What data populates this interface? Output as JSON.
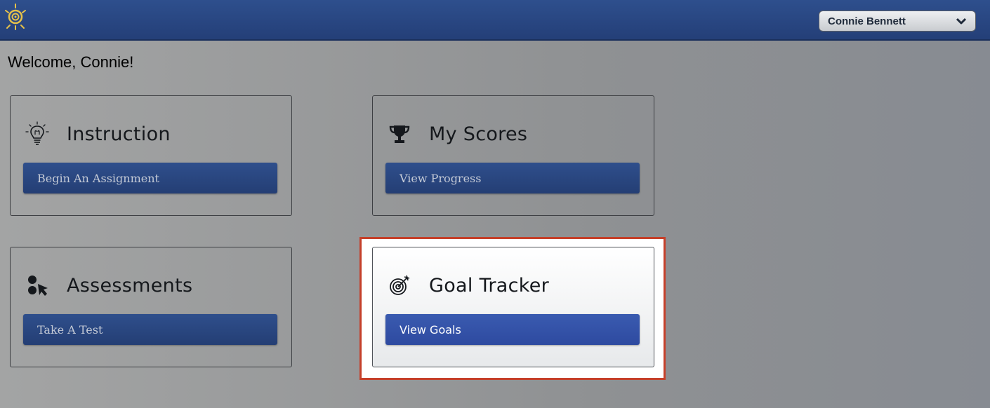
{
  "header": {
    "logo_icon": "sun-spiral-logo-icon",
    "user_select": {
      "selected": "Connie Bennett",
      "icon": "chevron-down-icon"
    }
  },
  "welcome": "Welcome, Connie!",
  "cards": [
    {
      "title": "Instruction",
      "icon": "lightbulb-icon",
      "button": "Begin An Assignment"
    },
    {
      "title": "My Scores",
      "icon": "trophy-icon",
      "button": "View Progress"
    },
    {
      "title": "Assessments",
      "icon": "assessment-cursor-icon",
      "button": "Take A Test"
    },
    {
      "title": "Goal Tracker",
      "icon": "target-icon",
      "button": "View Goals",
      "highlighted": true
    }
  ],
  "colors": {
    "header": "#2e4f8d",
    "button": "#2f4f8c",
    "active_button": "#3a5bb0",
    "highlight_border": "#c5402a"
  }
}
